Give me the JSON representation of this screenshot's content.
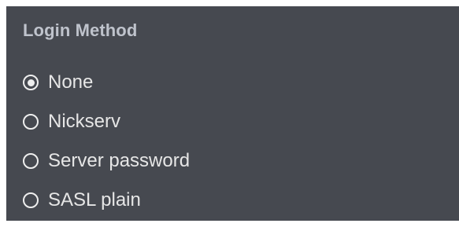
{
  "login_method": {
    "heading": "Login Method",
    "selected": "None",
    "options": [
      {
        "label": "None",
        "checked": true
      },
      {
        "label": "Nickserv",
        "checked": false
      },
      {
        "label": "Server password",
        "checked": false
      },
      {
        "label": "SASL plain",
        "checked": false
      }
    ]
  },
  "colors": {
    "panel_background": "#464950",
    "heading_text": "#bfc3cc",
    "option_text": "#e6e6e6"
  }
}
